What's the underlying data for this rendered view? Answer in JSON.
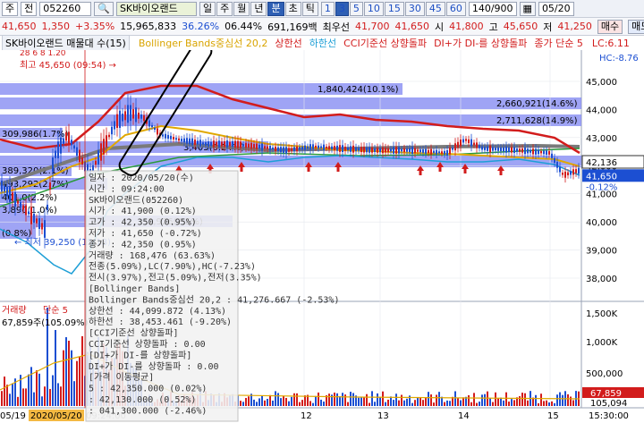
{
  "toolbar": {
    "menu": "주",
    "period": "전",
    "code": "052260",
    "name": "SK바이오랜드",
    "timeframes": [
      "일",
      "주",
      "월",
      "년",
      "분",
      "초",
      "틱"
    ],
    "intervals": [
      "1",
      "3",
      "5",
      "10",
      "15",
      "30",
      "45",
      "60"
    ],
    "selected_timeframe": "분",
    "selected_interval": "3",
    "count": "140/900",
    "date": "05/20"
  },
  "quote": {
    "price": "41,650",
    "change": "1,350",
    "change_pct": "+3.35%",
    "volume": "15,965,833",
    "ratio": "36.26%",
    "ratio2": "06.44%",
    "trade_value": "691,169백",
    "best_bid_label": "최우선",
    "best_ask": "41,700",
    "best_bid": "41,650",
    "open_label": "시",
    "open": "41,800",
    "high_label": "고",
    "high": "45,650",
    "low_label": "저",
    "low": "41,250",
    "buy_label": "매수",
    "sell_label": "매도"
  },
  "legend": {
    "title": "SK바이오랜드 매물대 수(15)",
    "items": [
      {
        "label": "Bollinger Bands중심선 20,2",
        "color": "#d9a400"
      },
      {
        "label": "상한선",
        "color": "#d21c1c"
      },
      {
        "label": "하한선",
        "color": "#1e9fd6"
      },
      {
        "label": "CCI기준선 상향돌파",
        "color": "#d21c1c"
      },
      {
        "label": "DI+가 DI-를 상향돌파",
        "color": "#d21c1c"
      },
      {
        "label": "종가 단순 5",
        "color": "#d21c1c"
      }
    ],
    "lc": "LC:6.11",
    "hc": "HC:-8.76"
  },
  "annotations": {
    "high": "최고 45,650 (09:54) →",
    "low": "← 최저 39,250 (15:18)",
    "box1": "1,840,424(10.1%)",
    "box2": "2,660,921(14.6%)",
    "box3": "2,711,628(14.9%)",
    "box4": "309,986(1.7%)",
    "box5": "389,320(2.1%)",
    "box6": "493,292(2.7%)",
    "box7": "401,0(2.2%)",
    "box8": "3,890(1.0%)",
    "box9": "(0.8%)",
    "box10": "3,405(6.24%)",
    "box11": "1,926(2.5%)",
    "ma_legend": "28 6 8 1.20"
  },
  "price_axis": {
    "ticks": [
      "45,000",
      "44,000",
      "43,000",
      "42,000",
      "41,000",
      "40,000",
      "39,000",
      "38,000"
    ],
    "current": "42,136",
    "last": "41,650",
    "last_pct": "-0.12%",
    "last_pct2": "+3.35%"
  },
  "volume_axis": {
    "ticks": [
      "1,500K",
      "1,000K",
      "500,000"
    ],
    "current": "67,859",
    "current2": "105,094",
    "label": "거래량",
    "ma_label": "단순 5",
    "vol_value": "67,859주(105.09%)"
  },
  "time_axis": {
    "labels": [
      "05/19",
      "2020/05/20",
      "12",
      "13",
      "14",
      "15",
      "15:30:00"
    ],
    "cursor_time": "09:24:00"
  },
  "tooltip": {
    "lines": [
      "일자    : 2020/05/20(수)",
      "시간    : 09:24:00",
      "SK바이오랜드(052260)",
      "시가    : 41,900 (0.12%)",
      "고가    : 42,350 (0.95%)",
      "저가    : 41,650 (-0.72%)",
      "종가    : 42,350 (0.95%)",
      "거래량  : 168,476 (63.63%)",
      "전종(5.09%),LC(7.90%),HC(-7.23%)",
      "전시(3.97%),전고(5.09%),전저(3.35%)",
      "[Bollinger Bands]",
      "Bollinger Bands중심선 20,2 : 41,276.667 (-2.53%)",
      "상한선   : 44,099.872 (4.13%)",
      "하한선   : 38,453.461 (-9.20%)",
      "[CCI기준선 상향돌파]",
      "CCI기준선 상향돌파 : 0.00",
      "[DI+가 DI-를 상향돌파]",
      "DI+가 DI-를 상향돌파 : 0.00",
      "[가격 이동평균]",
      "5       : 42,350.000 (0.02%)",
      "        : 42,130.000 (0.52%)",
      "        : 041,300.000 (-2.46%)"
    ]
  },
  "colors": {
    "upper_band": "#d21c1c",
    "lower_band": "#1e9fd6",
    "middle_band": "#e0a800",
    "ma_green": "#2a9a3a",
    "ma_gray": "#7a7a7a",
    "volume_box": "#7f86f2",
    "candle_up": "#d21c1c",
    "candle_down": "#1c4fd2"
  }
}
